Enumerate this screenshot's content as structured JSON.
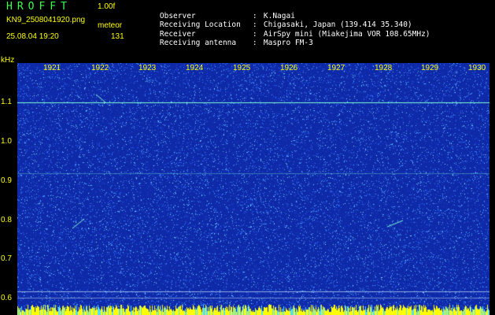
{
  "header": {
    "app_title": "HROFFT",
    "version": "1.00f",
    "filename": "KN9_2508041920.png",
    "mode": "meteor",
    "datetime": "25.08.04 19:20",
    "count": "131"
  },
  "info": [
    {
      "key": "Observer",
      "value": "K.Nagai"
    },
    {
      "key": "Receiving Location",
      "value": "Chigasaki, Japan (139.414 35.340)"
    },
    {
      "key": "Receiver",
      "value": "AirSpy mini (Miakejima VOR 108.65MHz)"
    },
    {
      "key": "Receiving antenna",
      "value": "Maspro FM-3"
    }
  ],
  "axes": {
    "unit": "kHz",
    "y_ticks": [
      "1.1",
      "1.0",
      "0.9",
      "0.8",
      "0.7",
      "0.6"
    ],
    "x_ticks": [
      "1921",
      "1922",
      "1923",
      "1924",
      "1925",
      "1926",
      "1927",
      "1928",
      "1929",
      "1930"
    ]
  },
  "colors": {
    "background": "#0f2aa8",
    "noise": "#2a6cff",
    "signal": "#7fffd4",
    "yellow": "#ffff00",
    "title": "#39ff4f"
  }
}
